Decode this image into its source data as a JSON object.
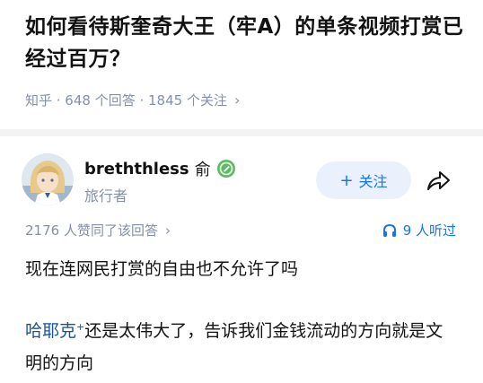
{
  "question": {
    "title": "如何看待斯奎奇大王（牢A）的单条视频打赏已经过百万？",
    "meta": "知乎 · 648 个回答 · 1845 个关注",
    "meta_chevron": "›"
  },
  "answer": {
    "author_name": "breththless",
    "author_tag": "俞",
    "author_role": "旅行者",
    "follow_plus": "+",
    "follow_label": "关注",
    "vote_summary": "2176 人赞同了该回答",
    "vote_chevron": "›",
    "listen_label": "9 人听过",
    "body_line1": "现在连网民打赏的自由也不允许了吗",
    "mention": "哈耶克",
    "mention_mark": "+",
    "body_rest": "还是太伟大了，告诉我们金钱流动的方向就是文明的方向"
  },
  "colors": {
    "link_blue": "#1772f6",
    "mention_blue": "#175199",
    "meta_gray": "#8590a6",
    "badge_green": "#5dbb63"
  },
  "icons": [
    "user-avatar",
    "verified-badge-icon",
    "share-icon",
    "headphones-icon",
    "chevron-right-icon"
  ]
}
